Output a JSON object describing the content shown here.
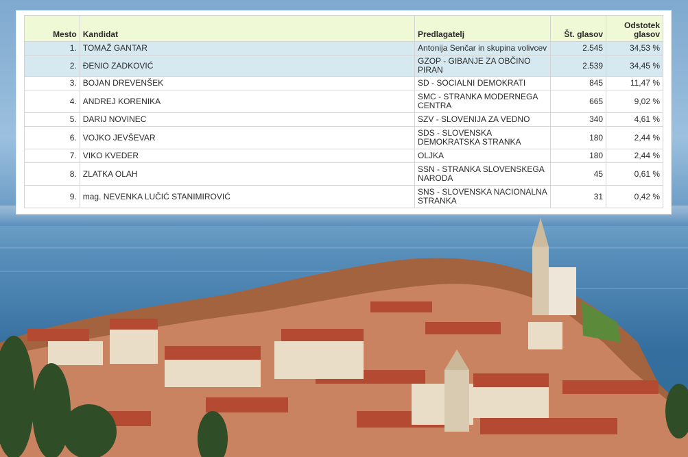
{
  "table": {
    "headers": {
      "rank": "Mesto",
      "candidate": "Kandidat",
      "proposer": "Predlagatelj",
      "votes": "Št. glasov",
      "percent_line1": "Odstotek",
      "percent_line2": "glasov"
    },
    "rows": [
      {
        "rank": "1.",
        "candidate": "TOMAŽ GANTAR",
        "proposer": "Antonija Senčar in skupina volivcev",
        "votes": "2.545",
        "percent": "34,53 %",
        "highlighted": true
      },
      {
        "rank": "2.",
        "candidate": "ĐENIO ZADKOVIĆ",
        "proposer": "GZOP - GIBANJE ZA OBČINO PIRAN",
        "votes": "2.539",
        "percent": "34,45 %",
        "highlighted": true
      },
      {
        "rank": "3.",
        "candidate": "BOJAN DREVENŠEK",
        "proposer": "SD - SOCIALNI DEMOKRATI",
        "votes": "845",
        "percent": "11,47 %",
        "highlighted": false
      },
      {
        "rank": "4.",
        "candidate": "ANDREJ KORENIKA",
        "proposer": "SMC - STRANKA MODERNEGA CENTRA",
        "votes": "665",
        "percent": "9,02 %",
        "highlighted": false
      },
      {
        "rank": "5.",
        "candidate": "DARIJ NOVINEC",
        "proposer": "SZV - SLOVENIJA ZA VEDNO",
        "votes": "340",
        "percent": "4,61 %",
        "highlighted": false
      },
      {
        "rank": "6.",
        "candidate": "VOJKO JEVŠEVAR",
        "proposer": "SDS - SLOVENSKA DEMOKRATSKA STRANKA",
        "votes": "180",
        "percent": "2,44 %",
        "highlighted": false
      },
      {
        "rank": "7.",
        "candidate": "VIKO KVEDER",
        "proposer": "OLJKA",
        "votes": "180",
        "percent": "2,44 %",
        "highlighted": false
      },
      {
        "rank": "8.",
        "candidate": "ZLATKA OLAH",
        "proposer": "SSN - STRANKA SLOVENSKEGA NARODA",
        "votes": "45",
        "percent": "0,61 %",
        "highlighted": false
      },
      {
        "rank": "9.",
        "candidate": "mag. NEVENKA LUČIĆ STANIMIROVIĆ",
        "proposer": "SNS - SLOVENSKA NACIONALNA STRANKA",
        "votes": "31",
        "percent": "0,42 %",
        "highlighted": false
      }
    ]
  },
  "colors": {
    "header_bg": "#f0f9d6",
    "highlight_bg": "#d6e9f1",
    "border": "#d4d4d4",
    "sea": "#3f79ab",
    "roofs": "#b8553a"
  }
}
